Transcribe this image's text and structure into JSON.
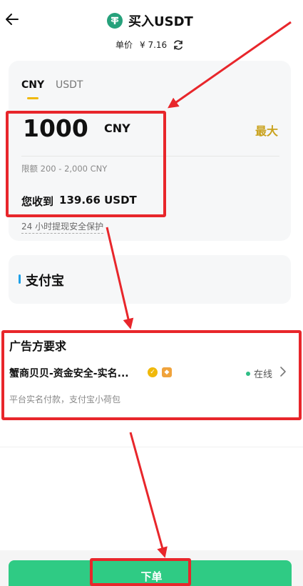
{
  "header": {
    "title": "买入USDT",
    "price_label": "单价",
    "price_value": "¥ 7.16"
  },
  "tabs": [
    "CNY",
    "USDT"
  ],
  "amount": {
    "value": "1000",
    "currency": "CNY",
    "max_label": "最大",
    "limit_text": "限额 200 - 2,000 CNY",
    "receive_label": "您收到",
    "receive_value": "139.66 USDT",
    "protection_text": "24 小时提现安全保护"
  },
  "payment": {
    "method": "支付宝",
    "bar_color": "#1da0e8"
  },
  "advertiser": {
    "section_title": "广告方要求",
    "merchant_name": "蟹商贝贝-资金安全-实名...",
    "status": "在线",
    "description": "平台实名付款，支付宝小荷包"
  },
  "footer": {
    "order_button": "下单"
  },
  "colors": {
    "accent_green": "#2fcb84",
    "max_gold": "#c9a21d",
    "annotation_red": "#e8262b",
    "tether_green": "#26a17b"
  }
}
